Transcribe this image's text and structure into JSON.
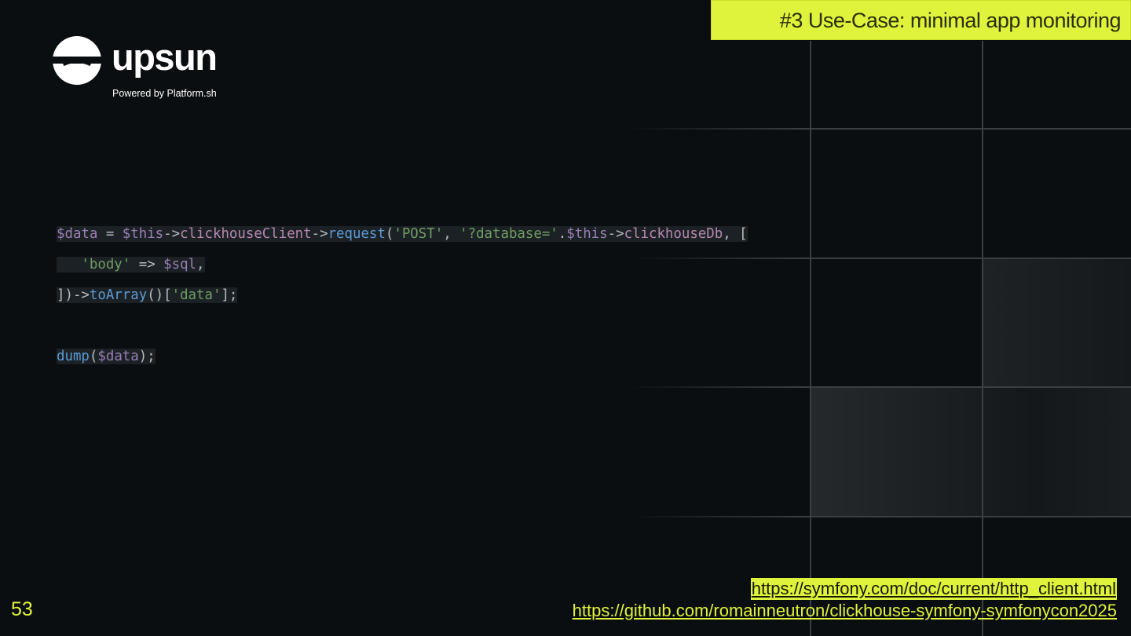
{
  "slide": {
    "title": "#3 Use-Case: minimal app monitoring",
    "page_number": "53"
  },
  "logo": {
    "name": "upsun",
    "tagline": "Powered by Platform.sh",
    "icon": "upsun-logo-icon"
  },
  "code": {
    "language": "php",
    "lines": [
      "$data = $this->clickhouseClient->request('POST', '?database='.$this->clickhouseDb, [",
      "    'body' => $sql,",
      "])->toArray()['data'];",
      "",
      "dump($data);"
    ]
  },
  "links": [
    "https://symfony.com/doc/current/http_client.html",
    "https://github.com/romainneutron/clickhouse-symfony-symfonycon2025"
  ],
  "colors": {
    "accent": "#e0f33c",
    "background": "#0b0e10",
    "code_background": "#1c2125"
  }
}
